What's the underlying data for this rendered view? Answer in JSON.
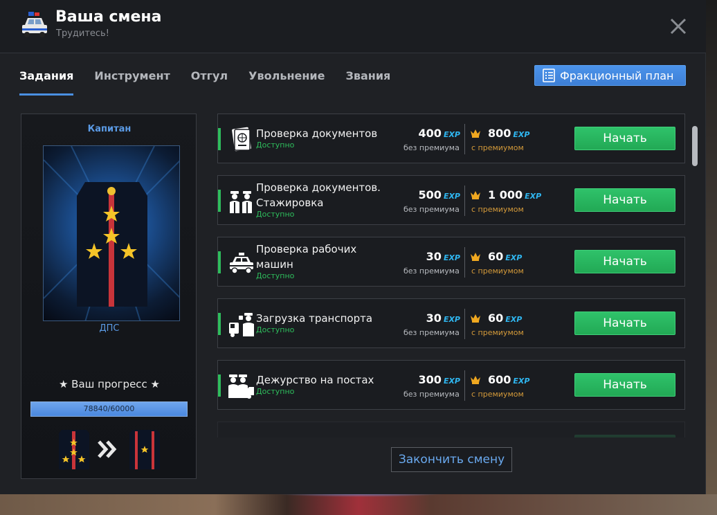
{
  "header": {
    "title": "Ваша смена",
    "subtitle": "Трудитесь!",
    "icon": "police-car-icon"
  },
  "tabs": [
    {
      "label": "Задания",
      "active": true
    },
    {
      "label": "Инструмент",
      "active": false
    },
    {
      "label": "Отгул",
      "active": false
    },
    {
      "label": "Увольнение",
      "active": false
    },
    {
      "label": "Звания",
      "active": false
    }
  ],
  "plan_button": {
    "label": "Фракционный план",
    "icon": "checklist-icon"
  },
  "rank": {
    "title": "Капитан",
    "department": "ДПС",
    "progress_label": "★ Ваш прогресс ★",
    "progress_text": "78840/60000",
    "progress_fraction": 1.0
  },
  "tasks": [
    {
      "name": "Проверка документов",
      "status": "Доступно",
      "exp_free": "400",
      "exp_premium": "800",
      "icon": "passport-icon"
    },
    {
      "name": "Проверка документов. Стажировка",
      "status": "Доступно",
      "exp_free": "500",
      "exp_premium": "1 000",
      "icon": "officers-icon"
    },
    {
      "name": "Проверка рабочих машин",
      "status": "Доступно",
      "exp_free": "30",
      "exp_premium": "60",
      "icon": "police-car-icon"
    },
    {
      "name": "Загрузка транспорта",
      "status": "Доступно",
      "exp_free": "30",
      "exp_premium": "60",
      "icon": "tow-officer-icon"
    },
    {
      "name": "Дежурство на постах",
      "status": "Доступно",
      "exp_free": "300",
      "exp_premium": "600",
      "icon": "patrol-post-icon"
    }
  ],
  "labels": {
    "exp_tag": "EXP",
    "no_premium": "без премиума",
    "with_premium": "с премиумом",
    "start": "Начать",
    "finish_shift": "Закончить смену"
  },
  "colors": {
    "accent_blue": "#4a90e2",
    "start_green": "#2ebd5c",
    "exp_cyan": "#2fb6f0",
    "premium_gold": "#d49a3a"
  }
}
